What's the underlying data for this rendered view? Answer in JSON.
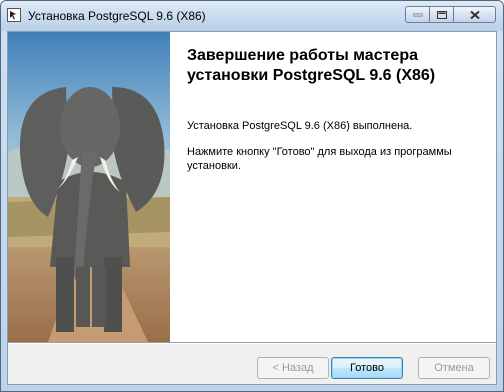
{
  "window": {
    "title": "Установка PostgreSQL 9.6 (X86)",
    "icon": "installer-icon",
    "controls": [
      "minimize-icon",
      "maximize-icon",
      "close-icon"
    ]
  },
  "page": {
    "heading": "Завершение работы мастера установки PostgreSQL 9.6 (X86)",
    "message1": "Установка PostgreSQL 9.6 (X86) выполнена.",
    "message2": "Нажмите кнопку \"Готово\" для выхода из программы установки."
  },
  "buttons": {
    "back": "< Назад",
    "finish": "Готово",
    "cancel": "Отмена"
  },
  "colors": {
    "titlebar": "#c8dbef",
    "default_button_border": "#3c7fb1"
  }
}
